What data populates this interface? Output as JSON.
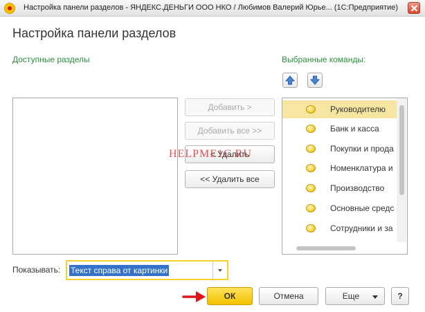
{
  "window": {
    "title": "Настройка панели разделов - ЯНДЕКС.ДЕНЬГИ ООО НКО / Любимов Валерий Юрье... (1С:Предприятие)",
    "icon": "1c-app-icon"
  },
  "dialog": {
    "heading": "Настройка панели разделов",
    "available_label": "Доступные разделы",
    "selected_label": "Выбранные команды:"
  },
  "buttons": {
    "add": "Добавить >",
    "add_all": "Добавить все >>",
    "remove": "< Удалить",
    "remove_all": "<< Удалить все",
    "ok": "ОК",
    "cancel": "Отмена",
    "more": "Еще",
    "help": "?"
  },
  "watermark": "HELPME1C.RU",
  "commands": [
    {
      "label": "Руководителю",
      "selected": true
    },
    {
      "label": "Банк и касса",
      "selected": false
    },
    {
      "label": "Покупки и прода",
      "selected": false
    },
    {
      "label": "Номенклатура и",
      "selected": false
    },
    {
      "label": "Производство",
      "selected": false
    },
    {
      "label": "Основные средс",
      "selected": false
    },
    {
      "label": "Сотрудники и за",
      "selected": false
    }
  ],
  "show": {
    "label": "Показывать:",
    "value": "Текст справа от картинки"
  },
  "colors": {
    "section_label": "#2a8f3b",
    "ok_button": "#f2c100",
    "selected_row": "#f6e6a2",
    "highlight_border": "#f3d12b",
    "arrow": "#e0121b"
  }
}
